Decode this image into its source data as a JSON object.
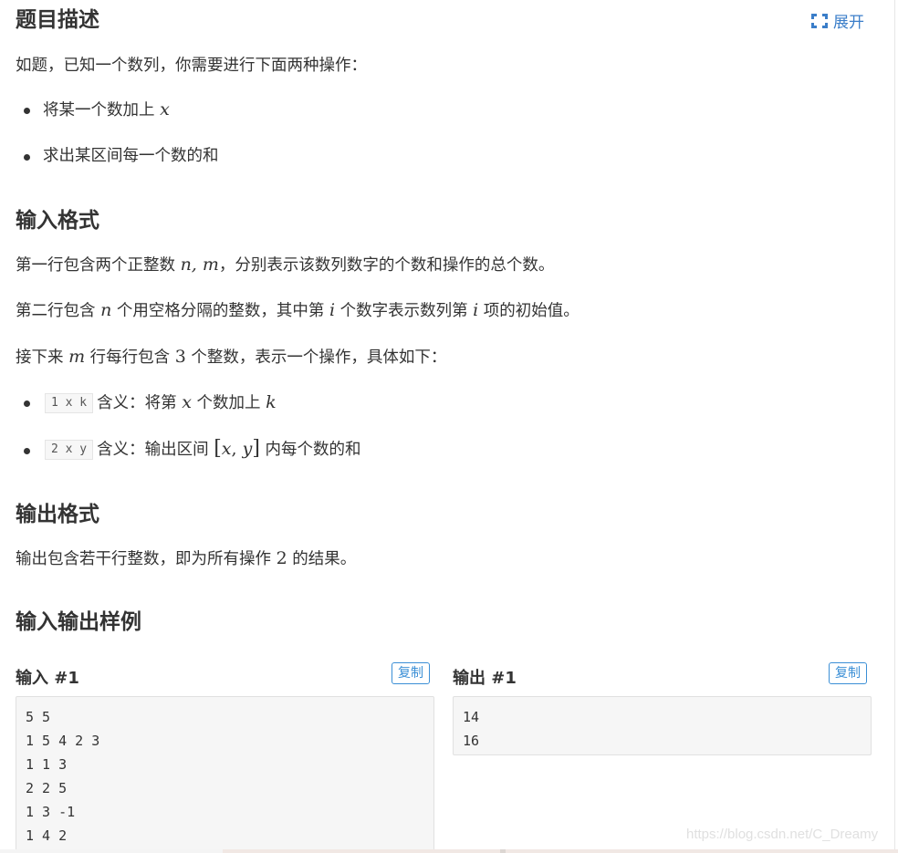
{
  "description": {
    "heading": "题目描述",
    "expand_label": "展开",
    "intro": "如题，已知一个数列，你需要进行下面两种操作：",
    "ops": [
      {
        "text": "将某一个数加上 ",
        "var": "x"
      },
      {
        "text": "求出某区间每一个数的和"
      }
    ]
  },
  "input_format": {
    "heading": "输入格式",
    "line1": {
      "pre": "第一行包含两个正整数 ",
      "math": "n, m",
      "post": "，分别表示该数列数字的个数和操作的总个数。"
    },
    "line2": {
      "pre": "第二行包含 ",
      "v1": "n",
      "mid1": " 个用空格分隔的整数，其中第 ",
      "v2": "i",
      "mid2": " 个数字表示数列第 ",
      "v3": "i",
      "post": " 项的初始值。"
    },
    "line3": {
      "pre": "接下来 ",
      "v1": "m",
      "mid": " 行每行包含 ",
      "num": "3",
      "post": " 个整数，表示一个操作，具体如下："
    },
    "cmds": [
      {
        "code": "1 x k",
        "pre": "含义：将第 ",
        "v1": "x",
        "mid": " 个数加上 ",
        "v2": "k"
      },
      {
        "code": "2 x y",
        "pre": "含义：输出区间 ",
        "lb": "[",
        "v1": "x",
        "comma": ", ",
        "v2": "y",
        "rb": "]",
        "post": " 内每个数的和"
      }
    ]
  },
  "output_format": {
    "heading": "输出格式",
    "line": {
      "pre": "输出包含若干行整数，即为所有操作 ",
      "num": "2",
      "post": " 的结果。"
    }
  },
  "samples": {
    "heading": "输入输出样例",
    "input_title": "输入 #1",
    "output_title": "输出 #1",
    "copy_label": "复制",
    "input_lines": [
      "5 5",
      "1 5 4 2 3",
      "1 1 3",
      "2 2 5",
      "1 3 -1",
      "1 4 2"
    ],
    "output_lines": [
      "14",
      "16"
    ]
  },
  "watermark": "https://blog.csdn.net/C_Dreamy"
}
